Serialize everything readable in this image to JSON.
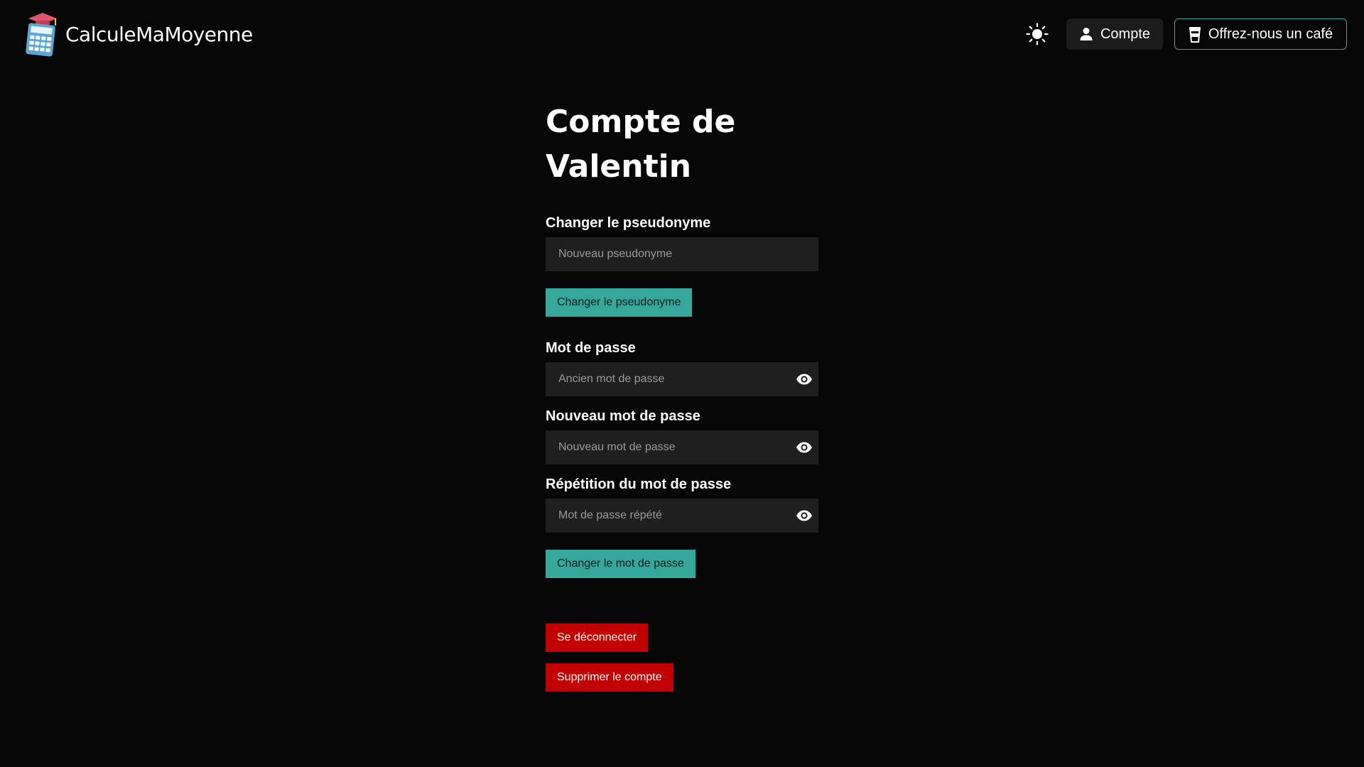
{
  "header": {
    "brand_name": "CalculeMaMoyenne",
    "theme_icon": "sun-icon",
    "account_label": "Compte",
    "account_icon": "person-icon",
    "coffee_label": "Offrez-nous un café",
    "coffee_icon": "coffee-cup-icon"
  },
  "main": {
    "title_line1": "Compte de",
    "title_line2": "Valentin",
    "pseudo_section": {
      "label": "Changer le pseudonyme",
      "placeholder": "Nouveau pseudonyme",
      "value": "",
      "button_label": "Changer le pseudonyme"
    },
    "password_section": {
      "old_label": "Mot de passe",
      "old_placeholder": "Ancien mot de passe",
      "new_label": "Nouveau mot de passe",
      "new_placeholder": "Nouveau mot de passe",
      "repeat_label": "Répétition du mot de passe",
      "repeat_placeholder": "Mot de passe répété",
      "toggle_icon": "eye-icon",
      "button_label": "Changer le mot de passe"
    },
    "logout_label": "Se déconnecter",
    "delete_label": "Supprimer le compte"
  },
  "colors": {
    "background": "#060606",
    "accent_teal": "#36a79b",
    "danger_red": "#c30000",
    "input_bg": "#1f1f1f"
  }
}
